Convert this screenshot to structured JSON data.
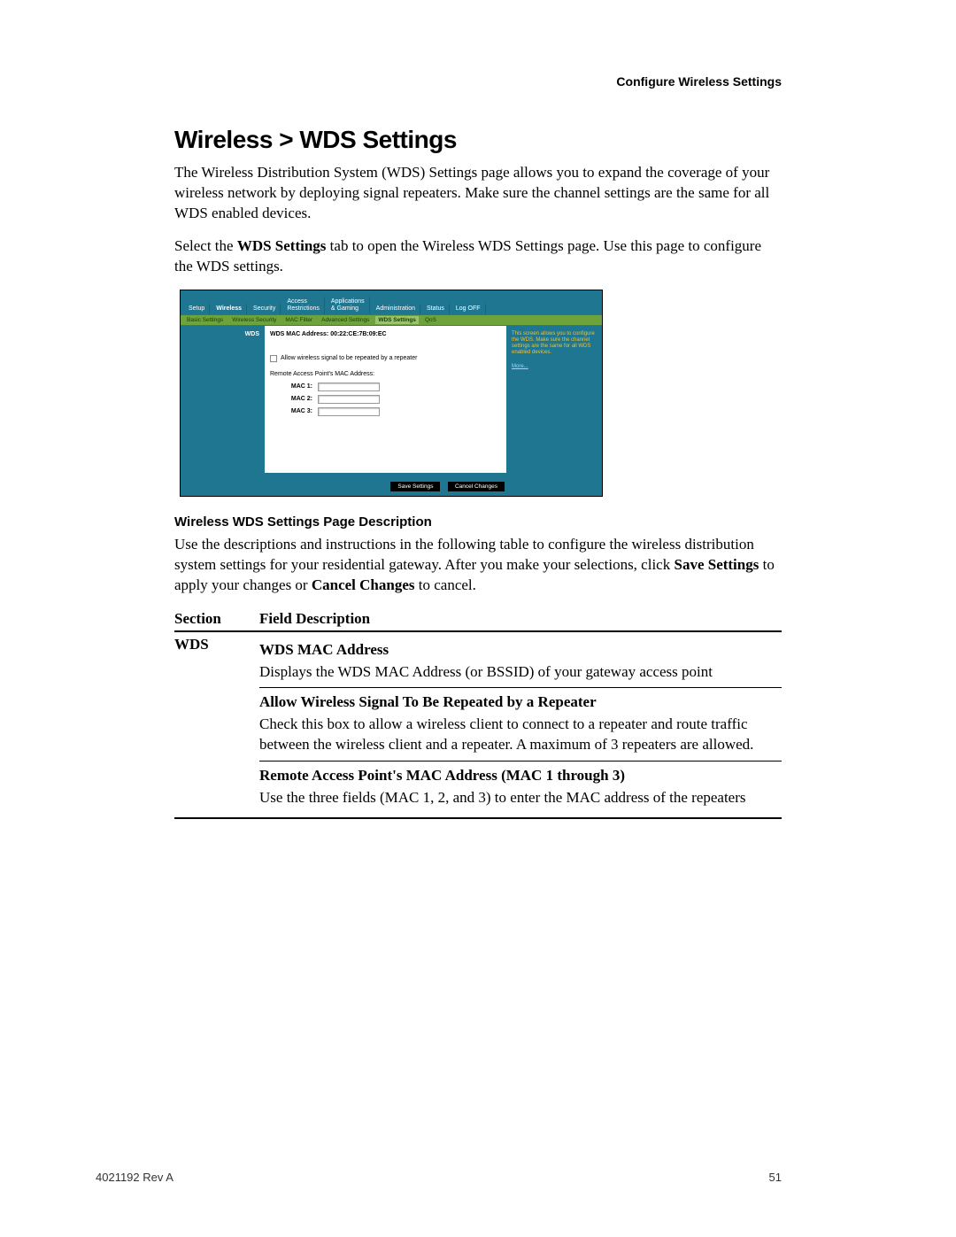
{
  "header": {
    "running": "Configure Wireless Settings"
  },
  "title": "Wireless > WDS Settings",
  "intro1": "The Wireless Distribution System (WDS) Settings page allows you to expand the coverage of your wireless network by deploying signal repeaters.  Make sure the channel settings are the same for all WDS enabled devices.",
  "intro2_pre": "Select the ",
  "intro2_bold": "WDS Settings",
  "intro2_post": " tab to open the Wireless WDS Settings page. Use this page to configure the WDS settings.",
  "router": {
    "tabs": [
      "Setup",
      "Wireless",
      "Security",
      "Access\nRestrictions",
      "Applications\n& Gaming",
      "Administration",
      "Status",
      "Log OFF"
    ],
    "active_tab": "Wireless",
    "subtabs": [
      "Basic Settings",
      "Wireless Security",
      "MAC Filter",
      "Advanced Settings",
      "WDS Settings",
      "QoS"
    ],
    "active_subtab": "WDS Settings",
    "left_label": "WDS",
    "mac_address_label": "WDS MAC Address: 00:22:CE:7B:09:EC",
    "allow_label": "Allow wireless signal to be repeated by a repeater",
    "remote_label": "Remote Access Point's MAC Address:",
    "mac_rows": [
      "MAC 1:",
      "MAC 2:",
      "MAC 3:"
    ],
    "help_text": "This screen allows you to configure the WDS. Make sure the channel settings are the same for all WDS enabled devices.",
    "more": "More...",
    "save": "Save Settings",
    "cancel": "Cancel Changes"
  },
  "subheading": "Wireless WDS Settings Page Description",
  "desc_intro_pre": "Use the descriptions and instructions in the following table to configure the wireless distribution system settings for your residential gateway. After you make your selections, click ",
  "desc_intro_b1": "Save Settings",
  "desc_intro_mid": " to apply your changes or ",
  "desc_intro_b2": "Cancel Changes",
  "desc_intro_post": " to cancel.",
  "table": {
    "col_section": "Section",
    "col_field": "Field Description",
    "section_label": "WDS",
    "fields": [
      {
        "title": "WDS MAC Address",
        "body": "Displays the WDS MAC Address (or BSSID) of your gateway access point"
      },
      {
        "title": "Allow Wireless Signal To Be Repeated by a Repeater",
        "body": "Check this box to allow a wireless client to connect to a repeater and route traffic between the wireless client and a repeater. A maximum of 3 repeaters are allowed."
      },
      {
        "title": "Remote Access Point's MAC Address (MAC 1 through 3)",
        "body": "Use the three fields (MAC 1, 2, and 3) to enter the MAC address of the repeaters"
      }
    ]
  },
  "footer": {
    "left": "4021192 Rev A",
    "right": "51"
  }
}
